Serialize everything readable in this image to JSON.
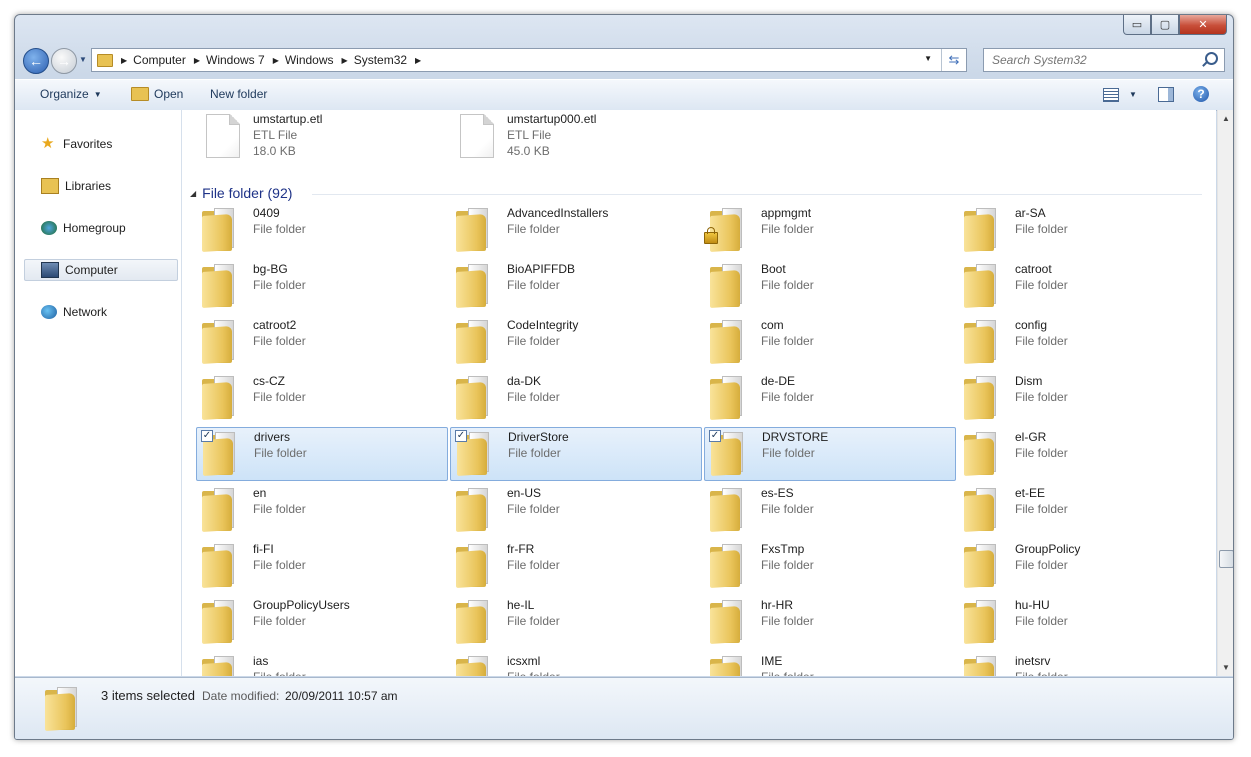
{
  "window": {
    "caption_minimize": "▭",
    "caption_maximize": "▢",
    "caption_close": "✕"
  },
  "navigation": {
    "back_symbol": "←",
    "forward_symbol": "→",
    "breadcrumbs": [
      "Computer",
      "Windows 7",
      "Windows",
      "System32"
    ],
    "search_placeholder": "Search System32"
  },
  "toolbar": {
    "organize_label": "Organize",
    "open_label": "Open",
    "new_folder_label": "New folder",
    "help_symbol": "?"
  },
  "sidebar": {
    "items": [
      {
        "label": "Favorites",
        "icon": "star-icon"
      },
      {
        "label": "Libraries",
        "icon": "libraries-icon"
      },
      {
        "label": "Homegroup",
        "icon": "homegroup-icon"
      },
      {
        "label": "Computer",
        "icon": "computer-icon"
      },
      {
        "label": "Network",
        "icon": "network-icon"
      }
    ]
  },
  "files": [
    {
      "name": "umstartup.etl",
      "type": "ETL File",
      "size": "18.0 KB"
    },
    {
      "name": "umstartup000.etl",
      "type": "ETL File",
      "size": "45.0 KB"
    }
  ],
  "group": {
    "title": "File folder (92)"
  },
  "folders": [
    {
      "name": "0409",
      "type": "File folder"
    },
    {
      "name": "AdvancedInstallers",
      "type": "File folder"
    },
    {
      "name": "appmgmt",
      "type": "File folder"
    },
    {
      "name": "ar-SA",
      "type": "File folder"
    },
    {
      "name": "bg-BG",
      "type": "File folder"
    },
    {
      "name": "BioAPIFFDB",
      "type": "File folder"
    },
    {
      "name": "Boot",
      "type": "File folder"
    },
    {
      "name": "catroot",
      "type": "File folder"
    },
    {
      "name": "catroot2",
      "type": "File folder"
    },
    {
      "name": "CodeIntegrity",
      "type": "File folder"
    },
    {
      "name": "com",
      "type": "File folder"
    },
    {
      "name": "config",
      "type": "File folder"
    },
    {
      "name": "cs-CZ",
      "type": "File folder"
    },
    {
      "name": "da-DK",
      "type": "File folder"
    },
    {
      "name": "de-DE",
      "type": "File folder"
    },
    {
      "name": "Dism",
      "type": "File folder"
    },
    {
      "name": "drivers",
      "type": "File folder"
    },
    {
      "name": "DriverStore",
      "type": "File folder"
    },
    {
      "name": "DRVSTORE",
      "type": "File folder"
    },
    {
      "name": "el-GR",
      "type": "File folder"
    },
    {
      "name": "en",
      "type": "File folder"
    },
    {
      "name": "en-US",
      "type": "File folder"
    },
    {
      "name": "es-ES",
      "type": "File folder"
    },
    {
      "name": "et-EE",
      "type": "File folder"
    },
    {
      "name": "fi-FI",
      "type": "File folder"
    },
    {
      "name": "fr-FR",
      "type": "File folder"
    },
    {
      "name": "FxsTmp",
      "type": "File folder"
    },
    {
      "name": "GroupPolicy",
      "type": "File folder"
    },
    {
      "name": "GroupPolicyUsers",
      "type": "File folder"
    },
    {
      "name": "he-IL",
      "type": "File folder"
    },
    {
      "name": "hr-HR",
      "type": "File folder"
    },
    {
      "name": "hu-HU",
      "type": "File folder"
    },
    {
      "name": "ias",
      "type": "File folder"
    },
    {
      "name": "icsxml",
      "type": "File folder"
    },
    {
      "name": "IME",
      "type": "File folder"
    },
    {
      "name": "inetsrv",
      "type": "File folder"
    }
  ],
  "selected_folders": [
    "drivers",
    "DriverStore",
    "DRVSTORE"
  ],
  "locked_folders": [
    "appmgmt"
  ],
  "checkbox_mark": "✓",
  "details": {
    "selection_text": "3 items selected",
    "date_label": "Date modified:",
    "date_value": "20/09/2011 10:57 am"
  }
}
